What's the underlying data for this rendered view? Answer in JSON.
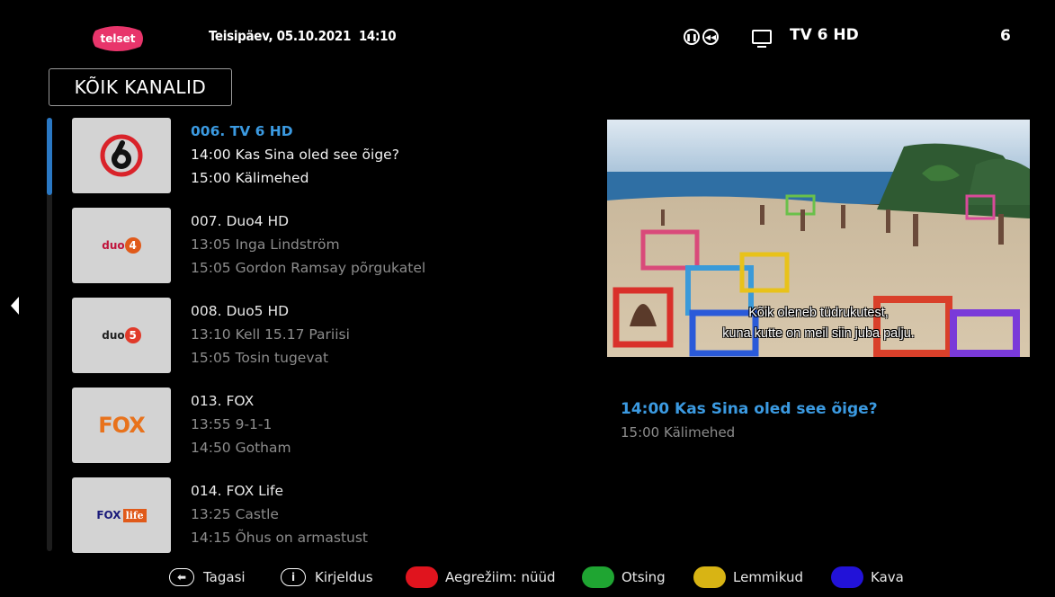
{
  "header": {
    "logo_text": "telset",
    "datetime": "Teisipäev, 05.10.2021  14:10",
    "current_channel": "TV 6 HD",
    "channel_number": "6"
  },
  "category": "KÕIK KANALID",
  "channels": [
    {
      "name": "006. TV 6 HD",
      "now": "14:00 Kas Sina oled see õige?",
      "next": "15:00 Kälimehed",
      "logo": "tv6-logo",
      "active": true
    },
    {
      "name": "007. Duo4 HD",
      "now": "13:05 Inga Lindström",
      "next": "15:05 Gordon Ramsay põrgukatel",
      "logo": "duo4-logo"
    },
    {
      "name": "008. Duo5 HD",
      "now": "13:10 Kell 15.17 Pariisi",
      "next": "15:05 Tosin tugevat",
      "logo": "duo5-logo"
    },
    {
      "name": "013. FOX",
      "now": "13:55 9-1-1",
      "next": "14:50 Gotham",
      "logo": "fox-logo"
    },
    {
      "name": "014. FOX Life",
      "now": "13:25 Castle",
      "next": "14:15 Õhus on armastust",
      "logo": "foxlife-logo"
    }
  ],
  "channel_logo_text": {
    "duo4": "duo",
    "duo4_num": "4",
    "duo5": "duo",
    "duo5_num": "5",
    "fox": "FOX",
    "foxlife_fox": "FOX",
    "foxlife_life": "life"
  },
  "preview": {
    "subtitle_line1": "Kõik oleneb tüdrukutest,",
    "subtitle_line2": "kuna kutte on meil siin juba palju."
  },
  "info": {
    "now": "14:00 Kas Sina oled see õige?",
    "next": "15:00 Kälimehed"
  },
  "footer": {
    "back": "Tagasi",
    "info_glyph": "i",
    "description": "Kirjeldus",
    "red": "Aegrežiim: nüüd",
    "green": "Otsing",
    "yellow": "Lemmikud",
    "blue": "Kava"
  },
  "colors": {
    "accent": "#3b9ae1",
    "red": "#e0141e",
    "green": "#1fa532",
    "yellow": "#d8b414",
    "blue": "#2212d8"
  }
}
